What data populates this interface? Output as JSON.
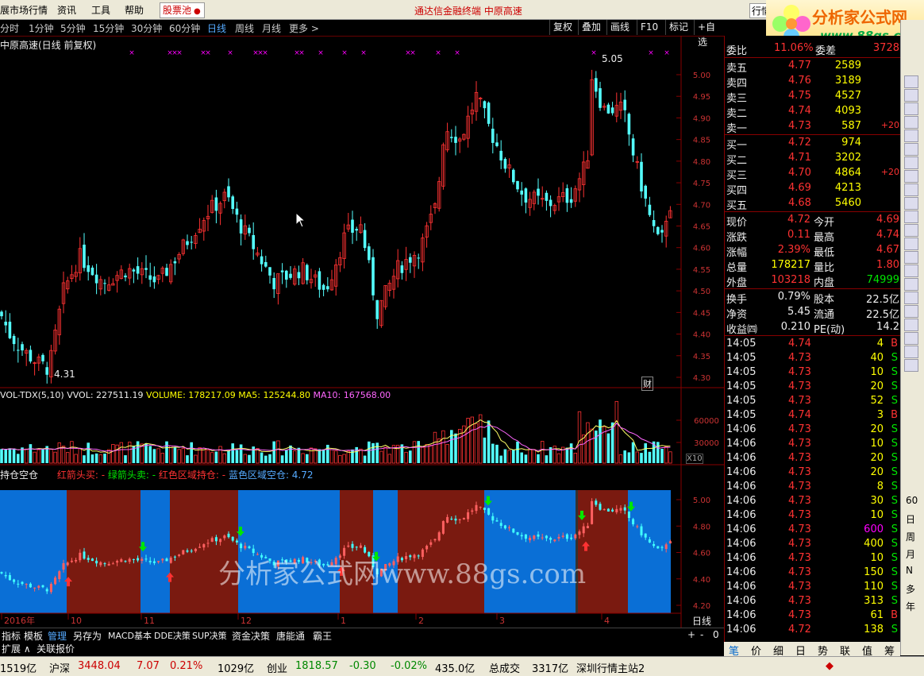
{
  "menu": {
    "items": [
      "展市场行情",
      "资讯",
      "工具",
      "帮助"
    ],
    "stock_pool": "股票池",
    "title": "通达信金融终端    中原高速",
    "cut_button": "行情"
  },
  "logo": {
    "text": "分析家公式网",
    "url": "www.88gs.com"
  },
  "periods": [
    "分时",
    "1分钟",
    "5分钟",
    "15分钟",
    "30分钟",
    "60分钟",
    "日线",
    "周线",
    "月线",
    "更多 >"
  ],
  "period_active": "日线",
  "right_buttons": [
    "复权",
    "叠加",
    "画线",
    "F10",
    "标记",
    "+自选"
  ],
  "chart": {
    "stock_title": "中原高速(日线 前复权)",
    "price_labels": [
      "5.00",
      "4.95",
      "4.90",
      "4.85",
      "4.80",
      "4.75",
      "4.70",
      "4.65",
      "4.60",
      "4.55",
      "4.50",
      "4.45",
      "4.40",
      "4.35",
      "4.30"
    ],
    "high_label": "5.05",
    "low_label": "4.31",
    "cai_label": "财",
    "vol_header": {
      "name": "VOL-TDX(5,10)",
      "vvol": "VVOL: 227511.19",
      "volume": "VOLUME: 178217.09",
      "ma5": "MA5: 125244.80",
      "ma10": "MA10: 167568.00"
    },
    "vol_labels": [
      "60000",
      "30000"
    ],
    "vol_unit": "X10",
    "ind_header": {
      "name": "持仓空仓",
      "red_arrow": "红箭头买: -",
      "green_arrow": "绿箭头卖: -",
      "red_zone": "红色区域持仓: -",
      "blue_zone": "蓝色区域空仓: 4.72"
    },
    "ind_labels": [
      "5.00",
      "4.80",
      "4.60",
      "4.40",
      "4.20"
    ],
    "watermark": "分析家公式网www.88gs.com",
    "month_labels": [
      "2016年",
      "10",
      "11",
      "12",
      "1",
      "2",
      "3",
      "4"
    ],
    "axis_mode": "日线",
    "colors": {
      "up": "#ff3232",
      "down": "#54ffff",
      "red_zone": "#7a1a10",
      "blue_zone": "#0a6fd6",
      "ma5": "#ffff66",
      "ma10": "#ff66ff"
    }
  },
  "bottom_tabs": [
    "指标",
    "模板",
    "管理",
    "另存为",
    "MACD基本",
    "DDE决策",
    "SUP决策",
    "资金决策",
    "唐能通",
    "霸王"
  ],
  "bottom_tab_active": "管理",
  "bottom_tabs2": [
    "扩展 ∧",
    "关联报价"
  ],
  "zoom_controls": [
    "+",
    "-",
    "0"
  ],
  "quote": {
    "weibi_label": "委比",
    "weibi": "11.06%",
    "weicha_label": "委差",
    "weicha": "3728",
    "asks": [
      {
        "label": "卖五",
        "price": "4.77",
        "vol": "2589",
        "chg": ""
      },
      {
        "label": "卖四",
        "price": "4.76",
        "vol": "3189",
        "chg": ""
      },
      {
        "label": "卖三",
        "price": "4.75",
        "vol": "4527",
        "chg": ""
      },
      {
        "label": "卖二",
        "price": "4.74",
        "vol": "4093",
        "chg": ""
      },
      {
        "label": "卖一",
        "price": "4.73",
        "vol": "587",
        "chg": "+20"
      }
    ],
    "bids": [
      {
        "label": "买一",
        "price": "4.72",
        "vol": "974",
        "chg": ""
      },
      {
        "label": "买二",
        "price": "4.71",
        "vol": "3202",
        "chg": ""
      },
      {
        "label": "买三",
        "price": "4.70",
        "vol": "4864",
        "chg": "+20"
      },
      {
        "label": "买四",
        "price": "4.69",
        "vol": "4213",
        "chg": ""
      },
      {
        "label": "买五",
        "price": "4.68",
        "vol": "5460",
        "chg": ""
      }
    ],
    "stats": [
      {
        "l1": "现价",
        "v1": "4.72",
        "l2": "今开",
        "v2": "4.69"
      },
      {
        "l1": "涨跌",
        "v1": "0.11",
        "l2": "最高",
        "v2": "4.74"
      },
      {
        "l1": "涨幅",
        "v1": "2.39%",
        "l2": "最低",
        "v2": "4.67"
      },
      {
        "l1": "总量",
        "v1": "178217",
        "l2": "量比",
        "v2": "1.80"
      },
      {
        "l1": "外盘",
        "v1": "103218",
        "l2": "内盘",
        "v2": "74999"
      }
    ],
    "stats2": [
      {
        "l1": "换手",
        "v1": "0.79%",
        "l2": "股本",
        "v2": "22.5亿"
      },
      {
        "l1": "净资",
        "v1": "5.45",
        "l2": "流通",
        "v2": "22.5亿"
      },
      {
        "l1": "收益㈣",
        "v1": "0.210",
        "l2": "PE(动)",
        "v2": "14.2"
      }
    ],
    "ticks": [
      {
        "t": "14:05",
        "p": "4.74",
        "v": "4",
        "d": "B"
      },
      {
        "t": "14:05",
        "p": "4.73",
        "v": "40",
        "d": "S"
      },
      {
        "t": "14:05",
        "p": "4.73",
        "v": "10",
        "d": "S"
      },
      {
        "t": "14:05",
        "p": "4.73",
        "v": "20",
        "d": "S"
      },
      {
        "t": "14:05",
        "p": "4.73",
        "v": "52",
        "d": "S"
      },
      {
        "t": "14:05",
        "p": "4.74",
        "v": "3",
        "d": "B"
      },
      {
        "t": "14:06",
        "p": "4.73",
        "v": "20",
        "d": "S"
      },
      {
        "t": "14:06",
        "p": "4.73",
        "v": "10",
        "d": "S"
      },
      {
        "t": "14:06",
        "p": "4.73",
        "v": "20",
        "d": "S"
      },
      {
        "t": "14:06",
        "p": "4.73",
        "v": "20",
        "d": "S"
      },
      {
        "t": "14:06",
        "p": "4.73",
        "v": "8",
        "d": "S"
      },
      {
        "t": "14:06",
        "p": "4.73",
        "v": "30",
        "d": "S"
      },
      {
        "t": "14:06",
        "p": "4.73",
        "v": "10",
        "d": "S"
      },
      {
        "t": "14:06",
        "p": "4.73",
        "v": "600",
        "d": "S"
      },
      {
        "t": "14:06",
        "p": "4.73",
        "v": "400",
        "d": "S"
      },
      {
        "t": "14:06",
        "p": "4.73",
        "v": "10",
        "d": "S"
      },
      {
        "t": "14:06",
        "p": "4.73",
        "v": "150",
        "d": "S"
      },
      {
        "t": "14:06",
        "p": "4.73",
        "v": "110",
        "d": "S"
      },
      {
        "t": "14:06",
        "p": "4.73",
        "v": "313",
        "d": "S"
      },
      {
        "t": "14:06",
        "p": "4.73",
        "v": "61",
        "d": "B"
      },
      {
        "t": "14:06",
        "p": "4.72",
        "v": "138",
        "d": "S"
      }
    ]
  },
  "right_tabs": [
    "笔",
    "价",
    "细",
    "日",
    "势",
    "联",
    "值",
    "筹"
  ],
  "side_labels": [
    "60",
    "日",
    "周",
    "月",
    "N",
    "多",
    "年"
  ],
  "status": {
    "a": "1519亿",
    "hs_label": "沪深",
    "hs": "3448.04",
    "hs_chg": "7.07",
    "hs_pct": "0.21%",
    "hs_amt": "1029亿",
    "cy_label": "创业",
    "cy": "1818.57",
    "cy_chg": "-0.30",
    "cy_pct": "-0.02%",
    "cy_amt": "435.0亿",
    "total_label": "总成交",
    "total": "3317亿",
    "site": "深圳行情主站2"
  }
}
